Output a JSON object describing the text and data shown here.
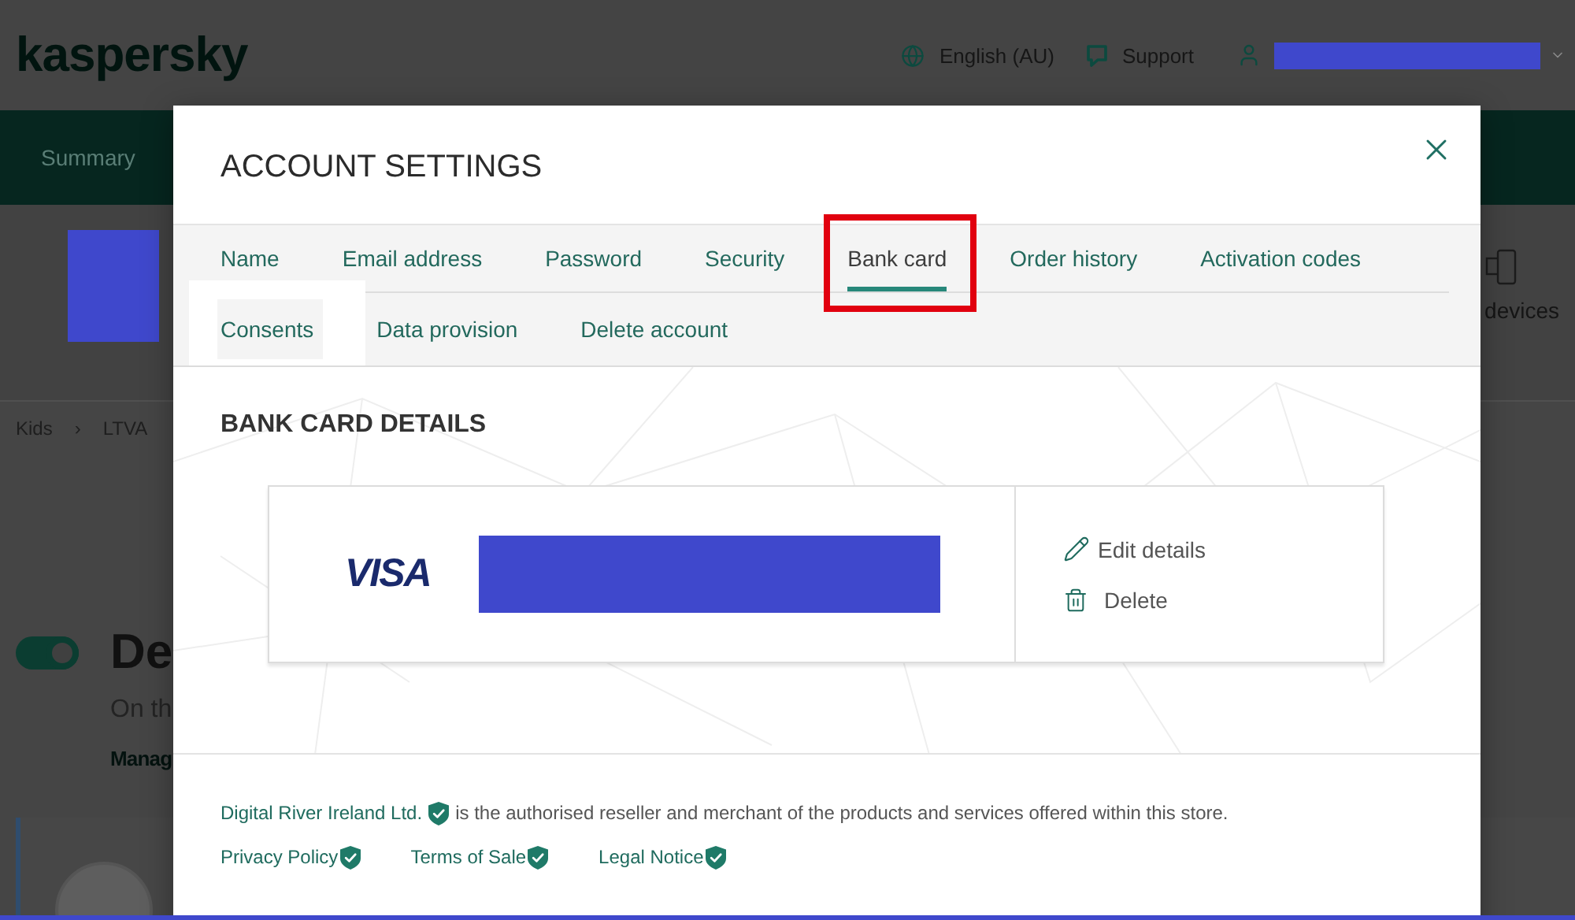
{
  "background_page": {
    "header": {
      "logo": "kaspersky",
      "language": "English (AU)",
      "support": "Support"
    },
    "nav": {
      "items": [
        "Summary"
      ]
    },
    "profile": {
      "devices_label": "devices"
    },
    "breadcrumb": {
      "items": [
        "Kids",
        "LTVA"
      ],
      "separator": "›"
    },
    "feature": {
      "toggle_on": true,
      "title": "De",
      "description": "On th",
      "link": "Manag"
    }
  },
  "dialog": {
    "title": "ACCOUNT SETTINGS",
    "tab_rows": [
      [
        {
          "label": "Name",
          "selected": false,
          "highlighted": false
        },
        {
          "label": "Email address",
          "selected": false,
          "highlighted": false
        },
        {
          "label": "Password",
          "selected": false,
          "highlighted": false
        },
        {
          "label": "Security",
          "selected": false,
          "highlighted": false
        },
        {
          "label": "Bank card",
          "selected": true,
          "highlighted": true
        },
        {
          "label": "Order history",
          "selected": false,
          "highlighted": false
        },
        {
          "label": "Activation codes",
          "selected": false,
          "highlighted": false
        }
      ],
      [
        {
          "label": "Consents",
          "selected": false,
          "highlighted": false
        },
        {
          "label": "Data provision",
          "selected": false,
          "highlighted": false
        },
        {
          "label": "Delete account",
          "selected": false,
          "highlighted": false
        }
      ]
    ],
    "section_title": "BANK CARD DETAILS",
    "card": {
      "brand": "VISA",
      "actions": [
        {
          "kind": "edit",
          "label": "Edit details"
        },
        {
          "kind": "delete",
          "label": "Delete"
        }
      ]
    },
    "footer": {
      "merchant": "Digital River Ireland Ltd.",
      "statement": "is the authorised reseller and merchant of the products and services offered within this store.",
      "links": [
        "Privacy Policy",
        "Terms of Sale",
        "Legal Notice"
      ]
    }
  }
}
